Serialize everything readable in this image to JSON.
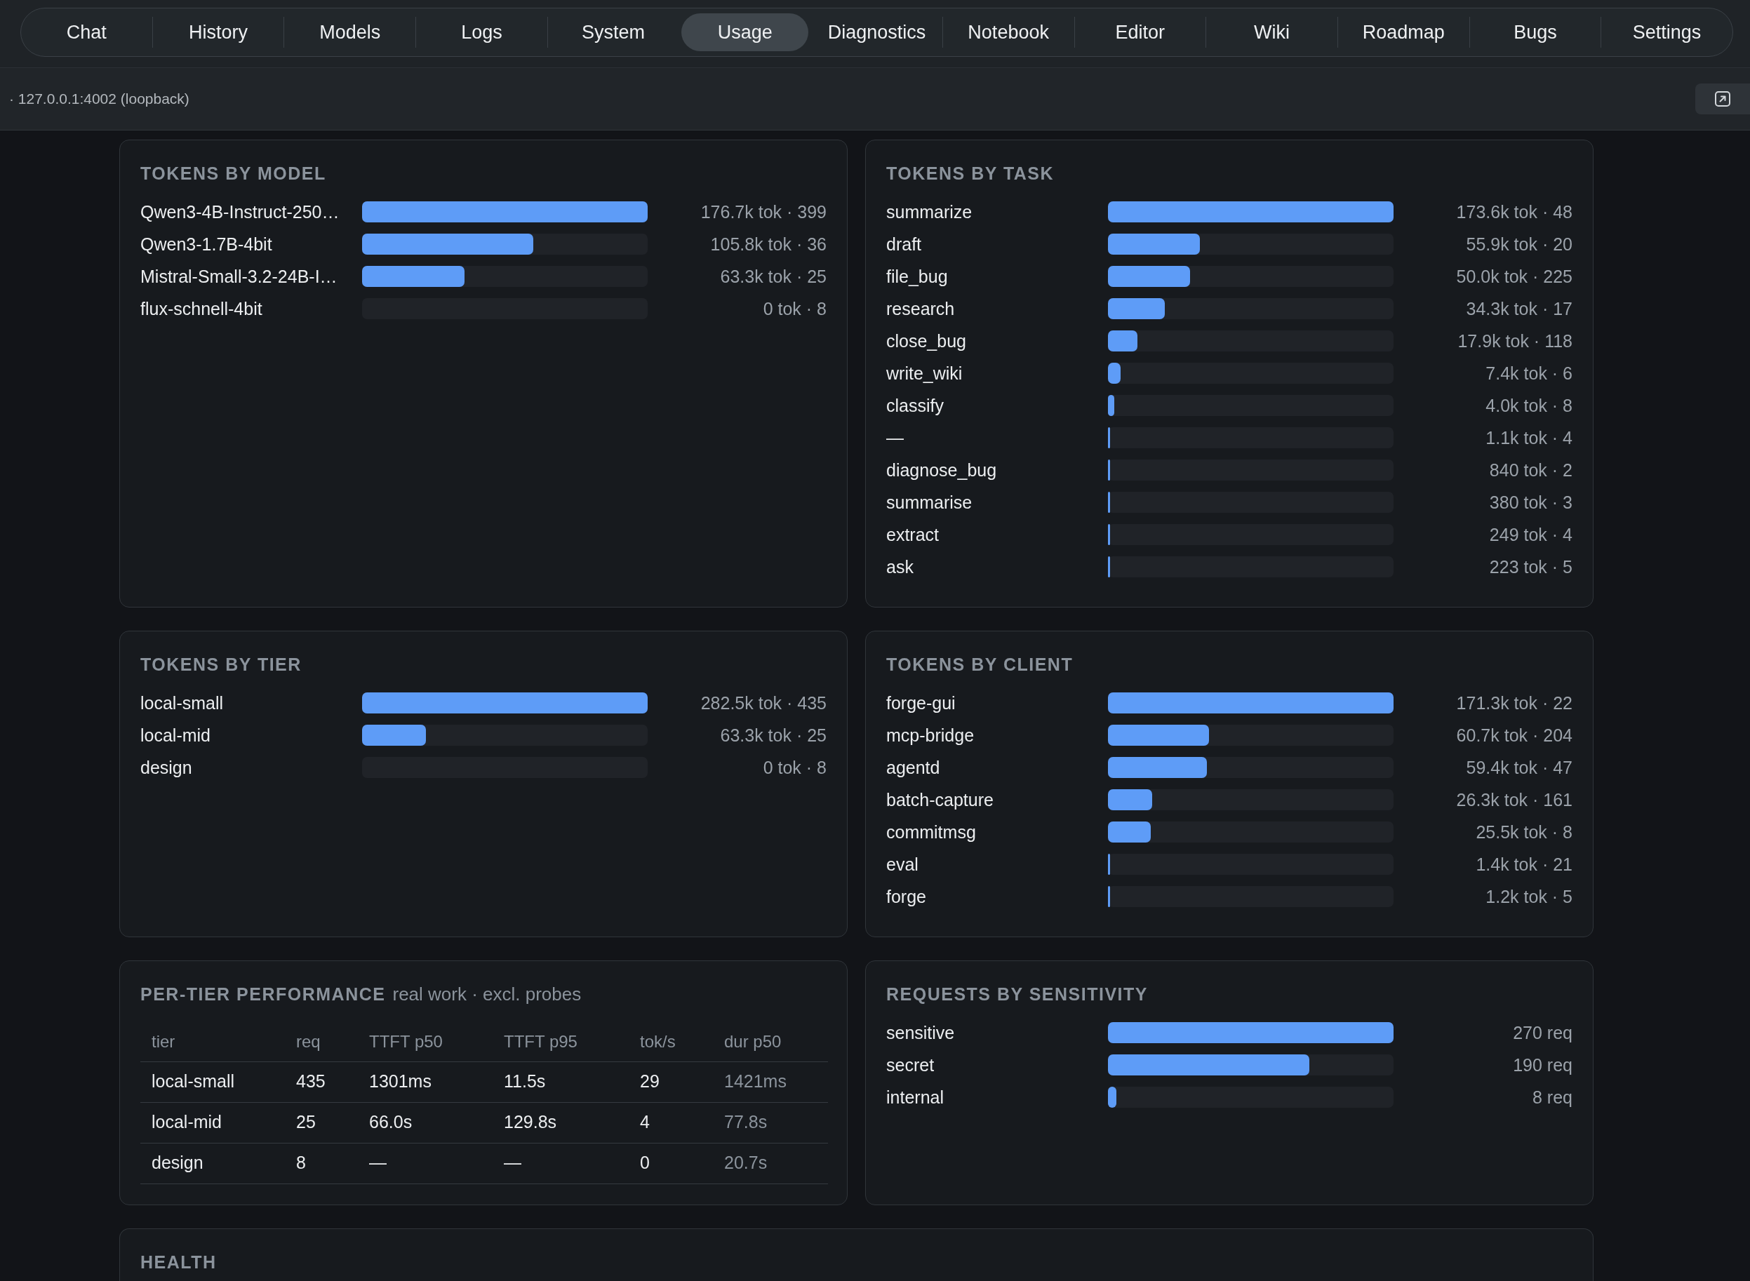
{
  "nav": {
    "tabs": [
      {
        "label": "Chat",
        "selected": false
      },
      {
        "label": "History",
        "selected": false
      },
      {
        "label": "Models",
        "selected": false
      },
      {
        "label": "Logs",
        "selected": false
      },
      {
        "label": "System",
        "selected": false
      },
      {
        "label": "Usage",
        "selected": true
      },
      {
        "label": "Diagnostics",
        "selected": false
      },
      {
        "label": "Notebook",
        "selected": false
      },
      {
        "label": "Editor",
        "selected": false
      },
      {
        "label": "Wiki",
        "selected": false
      },
      {
        "label": "Roadmap",
        "selected": false
      },
      {
        "label": "Bugs",
        "selected": false
      },
      {
        "label": "Settings",
        "selected": false
      }
    ]
  },
  "info_bar": {
    "address": "· 127.0.0.1:4002 (loopback)"
  },
  "panels": [
    {
      "kind": "bars",
      "title": "TOKENS BY MODEL",
      "rows": [
        {
          "label": "Qwen3-4B-Instruct-250…",
          "level": 1,
          "reading": "176.7k tok · 399"
        },
        {
          "label": "Qwen3-1.7B-4bit",
          "level": 0.599,
          "reading": "105.8k tok · 36"
        },
        {
          "label": "Mistral-Small-3.2-24B-I…",
          "level": 0.358,
          "reading": "63.3k tok · 25"
        },
        {
          "label": "flux-schnell-4bit",
          "level": 0,
          "reading": "0 tok · 8"
        }
      ]
    },
    {
      "kind": "bars",
      "title": "TOKENS BY TASK",
      "rows": [
        {
          "label": "summarize",
          "level": 1,
          "reading": "173.6k tok · 48"
        },
        {
          "label": "draft",
          "level": 0.322,
          "reading": "55.9k tok · 20"
        },
        {
          "label": "file_bug",
          "level": 0.288,
          "reading": "50.0k tok · 225"
        },
        {
          "label": "research",
          "level": 0.198,
          "reading": "34.3k tok · 17"
        },
        {
          "label": "close_bug",
          "level": 0.103,
          "reading": "17.9k tok · 118"
        },
        {
          "label": "write_wiki",
          "level": 0.043,
          "reading": "7.4k tok · 6"
        },
        {
          "label": "classify",
          "level": 0.023,
          "reading": "4.0k tok · 8"
        },
        {
          "label": "—",
          "level": 0.006,
          "reading": "1.1k tok · 4"
        },
        {
          "label": "diagnose_bug",
          "level": 0.005,
          "reading": "840 tok · 2"
        },
        {
          "label": "summarise",
          "level": 0.002,
          "reading": "380 tok · 3"
        },
        {
          "label": "extract",
          "level": 0.0014,
          "reading": "249 tok · 4"
        },
        {
          "label": "ask",
          "level": 0.0013,
          "reading": "223 tok · 5"
        }
      ]
    },
    {
      "kind": "bars",
      "title": "TOKENS BY TIER",
      "rows": [
        {
          "label": "local-small",
          "level": 1,
          "reading": "282.5k tok · 435"
        },
        {
          "label": "local-mid",
          "level": 0.224,
          "reading": "63.3k tok · 25"
        },
        {
          "label": "design",
          "level": 0,
          "reading": "0 tok · 8"
        }
      ]
    },
    {
      "kind": "bars",
      "title": "TOKENS BY CLIENT",
      "rows": [
        {
          "label": "forge-gui",
          "level": 1,
          "reading": "171.3k tok · 22"
        },
        {
          "label": "mcp-bridge",
          "level": 0.354,
          "reading": "60.7k tok · 204"
        },
        {
          "label": "agentd",
          "level": 0.347,
          "reading": "59.4k tok · 47"
        },
        {
          "label": "batch-capture",
          "level": 0.154,
          "reading": "26.3k tok · 161"
        },
        {
          "label": "commitmsg",
          "level": 0.149,
          "reading": "25.5k tok · 8"
        },
        {
          "label": "eval",
          "level": 0.008,
          "reading": "1.4k tok · 21"
        },
        {
          "label": "forge",
          "level": 0.007,
          "reading": "1.2k tok · 5"
        }
      ]
    },
    {
      "kind": "table",
      "title": "PER-TIER PERFORMANCE",
      "subtitle": "real work · excl. probes",
      "columns": [
        "tier",
        "req",
        "TTFT p50",
        "TTFT p95",
        "tok/s",
        "dur p50"
      ],
      "rows": [
        [
          "local-small",
          "435",
          "1301ms",
          "11.5s",
          "29",
          "1421ms"
        ],
        [
          "local-mid",
          "25",
          "66.0s",
          "129.8s",
          "4",
          "77.8s"
        ],
        [
          "design",
          "8",
          "—",
          "—",
          "0",
          "20.7s"
        ]
      ]
    },
    {
      "kind": "bars",
      "title": "REQUESTS BY SENSITIVITY",
      "rows": [
        {
          "label": "sensitive",
          "level": 1,
          "reading": "270 req"
        },
        {
          "label": "secret",
          "level": 0.704,
          "reading": "190 req"
        },
        {
          "label": "internal",
          "level": 0.03,
          "reading": "8 req"
        }
      ]
    },
    {
      "kind": "section",
      "title": "HEALTH"
    }
  ]
}
